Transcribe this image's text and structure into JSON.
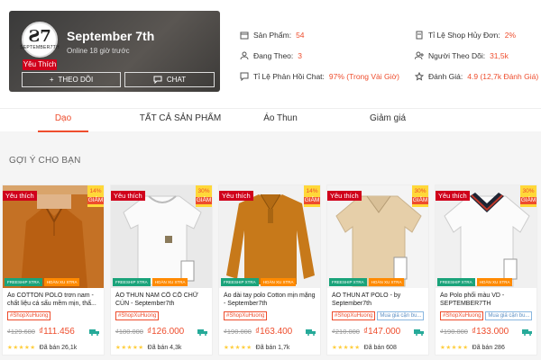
{
  "shop": {
    "name": "September 7th",
    "online": "Online 18 giờ trước",
    "badge": "Yêu Thích",
    "logo_mark": "Ƨ7",
    "logo_text": "SEPTEMBER7TH",
    "follow_label": "THEO DÕI",
    "chat_label": "CHAT"
  },
  "stats": {
    "products_label": "Sản Phẩm:",
    "products_value": "54",
    "following_label": "Đang Theo:",
    "following_value": "3",
    "response_label": "Tỉ Lệ Phản Hồi Chat:",
    "response_value": "97% (Trong Vài Giờ)",
    "cancel_label": "Tỉ Lệ Shop Hủy Đơn:",
    "cancel_value": "2%",
    "followers_label": "Người Theo Dõi:",
    "followers_value": "31,5k",
    "rating_label": "Đánh Giá:",
    "rating_value": "4.9 (12,7k Đánh Giá)"
  },
  "tabs": [
    "Dạo",
    "TẤT CẢ SẢN PHẨM",
    "Áo Thun",
    "Giảm giá"
  ],
  "active_tab": 0,
  "section_title": "GỢI Ý CHO BẠN",
  "colors": {
    "accent": "#ee4d2d",
    "badge": "#d0011b"
  },
  "products": [
    {
      "name": "Áo COTTON POLO trơn nam - chất liệu cá sấu mềm mịn, thấ...",
      "fav": "Yêu thích",
      "disc_pct": "14%",
      "disc_label": "GIẢM",
      "tags": [
        "#ShopXuHuong"
      ],
      "old_price": "₫129.600",
      "new_price": "₫111.456",
      "sold": "Đã bán 26,1k",
      "stars": "★★★★★",
      "promo1": "FREESHIP XTRA",
      "promo2": "HOÀN XU XTRA"
    },
    {
      "name": "ÁO THUN NAM CỔ CỔ CHỮ CÚN - September7th",
      "fav": "Yêu thích",
      "disc_pct": "30%",
      "disc_label": "GIẢM",
      "tags": [
        "#ShopXuHuong"
      ],
      "old_price": "₫180.000",
      "new_price": "₫126.000",
      "sold": "Đã bán 4,3k",
      "stars": "★★★★★",
      "promo1": "FREESHIP XTRA",
      "promo2": "HOÀN XU XTRA"
    },
    {
      "name": "Áo dài tay polo Cotton mịn mặng - September7th",
      "fav": "Yêu thích",
      "disc_pct": "14%",
      "disc_label": "GIẢM",
      "tags": [
        "#ShopXuHuong"
      ],
      "old_price": "₫190.000",
      "new_price": "₫163.400",
      "sold": "Đã bán 1,7k",
      "stars": "★★★★★",
      "promo1": "FREESHIP XTRA",
      "promo2": "HOÀN XU XTRA"
    },
    {
      "name": "ÁO THUN AT POLO - by September7th",
      "fav": "Yêu thích",
      "disc_pct": "30%",
      "disc_label": "GIẢM",
      "tags": [
        "#ShopXuHuong",
        "Mua giá cận bu..."
      ],
      "old_price": "₫210.000",
      "new_price": "₫147.000",
      "sold": "Đã bán 608",
      "stars": "★★★★★",
      "promo1": "FREESHIP XTRA",
      "promo2": "HOÀN XU XTRA"
    },
    {
      "name": "Áo Polo phối màu VD - SEPTEMBER7TH",
      "fav": "Yêu thích",
      "disc_pct": "30%",
      "disc_label": "GIẢM",
      "tags": [
        "#ShopXuHuong",
        "Mua giá cận bu..."
      ],
      "old_price": "₫190.000",
      "new_price": "₫133.000",
      "sold": "Đã bán 286",
      "stars": "★★★★★",
      "promo1": "FREESHIP XTRA",
      "promo2": "HOÀN XU XTRA"
    }
  ]
}
